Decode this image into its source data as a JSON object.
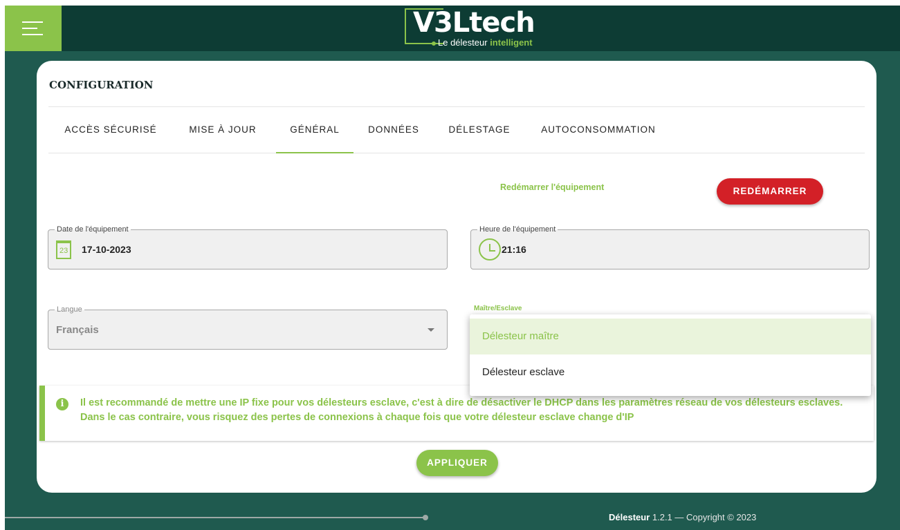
{
  "header": {
    "logo_main": "V3Ltech",
    "logo_sub": "Le délesteur",
    "logo_sub_accent": "intelligent"
  },
  "config": {
    "title": "CONFIGURATION",
    "tabs": [
      {
        "label": "ACCÈS SÉCURISÉ"
      },
      {
        "label": "MISE À JOUR"
      },
      {
        "label": "GÉNÉRAL",
        "active": true
      },
      {
        "label": "DONNÉES"
      },
      {
        "label": "DÉLESTAGE"
      },
      {
        "label": "AUTOCONSOMMATION"
      }
    ],
    "restart_label": "Redémarrer l'équipement",
    "restart_button": "REDÉMARRER",
    "date_field": {
      "label": "Date de l'équipement",
      "value": "17-10-2023",
      "icon_day": "23"
    },
    "time_field": {
      "label": "Heure de l'équipement",
      "value": "21:16"
    },
    "language_select": {
      "label": "Langue",
      "value": "Français"
    },
    "master_slave_label": "Maître/Esclave",
    "dropdown": {
      "options": [
        "Délesteur maître",
        "Délesteur esclave"
      ],
      "selected": "Délesteur maître"
    },
    "info_message": "Il est recommandé de mettre une IP fixe pour vos délesteurs esclave, c'est à dire de désactiver le DHCP dans les paramètres réseau de vos délesteurs esclaves. Dans le cas contraire, vous risquez des pertes de connexions à chaque fois que votre délesteur esclave change d'IP",
    "apply_button": "APPLIQUER"
  },
  "footer": {
    "app_name": "Délesteur",
    "text": "1.2.1 — Copyright © 2023"
  },
  "colors": {
    "accent": "#8bc34a",
    "danger": "#d32027",
    "topbar": "#0d3c34",
    "background": "#1f5a4f"
  }
}
